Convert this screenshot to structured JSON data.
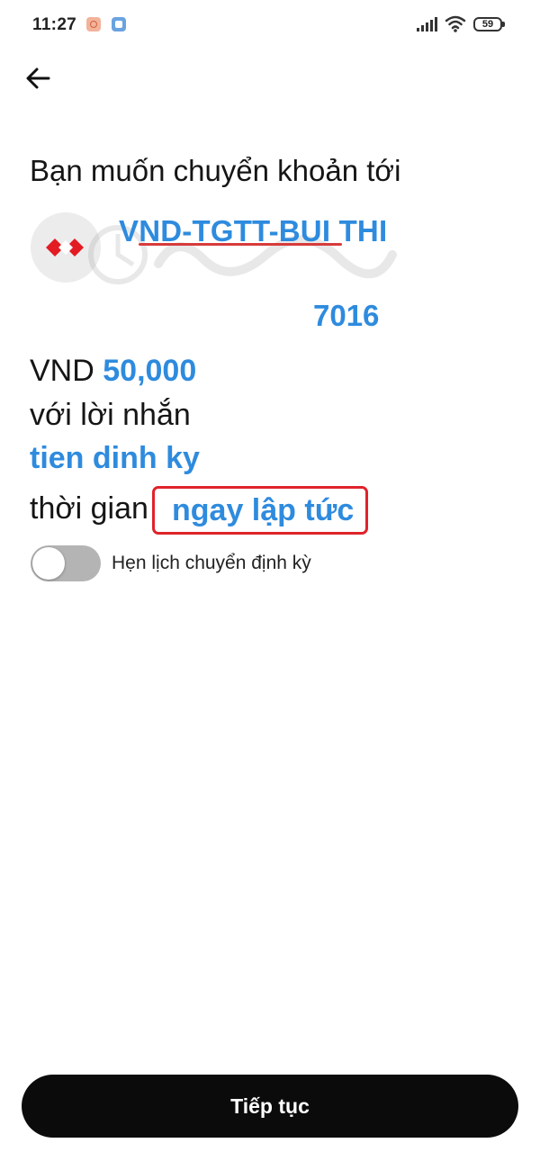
{
  "status_bar": {
    "time": "11:27",
    "battery": "59",
    "icons": [
      "camera-notification-icon",
      "app-notification-icon",
      "signal-icon",
      "wifi-icon",
      "battery-icon"
    ]
  },
  "nav": {
    "back_icon": "arrow-left-icon"
  },
  "transfer": {
    "headline": "Bạn muốn chuyển khoản tới",
    "recipient_name": "VND-TGTT-BUI THI",
    "account_number": "7016",
    "currency": "VND",
    "amount": "50,000",
    "message_label": "với lời nhắn",
    "message": "tien dinh ky",
    "time_label": "thời gian",
    "time_value": "ngay lập tức",
    "schedule_label": "Hẹn lịch chuyển định kỳ",
    "schedule_enabled": false
  },
  "actions": {
    "continue_label": "Tiếp tục"
  },
  "colors": {
    "accent": "#2e8bde",
    "highlight_box": "#e0232b",
    "button": "#0b0b0b",
    "bank_logo": "#e31b23"
  }
}
